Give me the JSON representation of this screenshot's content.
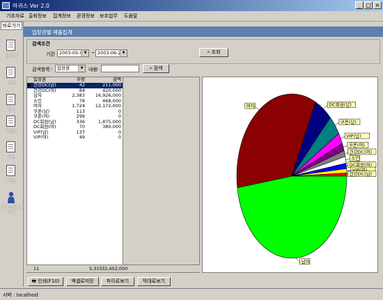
{
  "window": {
    "title": "아귀스 Ver 2.0"
  },
  "menu": [
    "기초자료",
    "출퇴정보",
    "집계정보",
    "환경정보",
    "보조업무",
    "도움말"
  ],
  "sidebar": {
    "shortcut_label": "바로가기",
    "items": [
      {
        "label": "입장권",
        "icon": "document-icon"
      },
      {
        "label": "상품",
        "icon": "document-icon"
      },
      {
        "label": "코너",
        "icon": "document-icon"
      },
      {
        "label": "카운터",
        "icon": "document-icon"
      },
      {
        "label": "카드",
        "icon": "document-icon"
      },
      {
        "label": "계정",
        "icon": "document-icon"
      },
      {
        "label": "아귀스에 대하여",
        "icon": "person-icon"
      }
    ]
  },
  "panel": {
    "title": "입장권별 매출집계"
  },
  "filters": {
    "section_title": "검색조건",
    "period_label": "기간",
    "date_from": "2003-05-02",
    "date_sep": "~",
    "date_to": "2003-06-25",
    "query_button": "조회",
    "search_item_label": "검색항목",
    "search_item_value": "입장권",
    "content_label": "내용",
    "content_value": "",
    "search_button": "검색"
  },
  "table": {
    "columns": [
      "입장권",
      "수량",
      "금액"
    ],
    "rows": [
      {
        "name": "건강DC(남)",
        "qty": "42",
        "amount": "211,000",
        "selected": true
      },
      {
        "name": "건강DC(여)",
        "qty": "84",
        "amount": "420,000"
      },
      {
        "name": "남자",
        "qty": "2,383",
        "amount": "16,926,000"
      },
      {
        "name": "소인",
        "qty": "78",
        "amount": "468,000"
      },
      {
        "name": "여자",
        "qty": "1,724",
        "amount": "12,172,000"
      },
      {
        "name": "쿠폰(남)",
        "qty": "113",
        "amount": "0"
      },
      {
        "name": "쿠폰(여)",
        "qty": "299",
        "amount": "0"
      },
      {
        "name": "DC회원(남)",
        "qty": "336",
        "amount": "1,875,000"
      },
      {
        "name": "DC회원(여)",
        "qty": "70",
        "amount": "380,000"
      },
      {
        "name": "VIP(남)",
        "qty": "137",
        "amount": "0"
      },
      {
        "name": "VIP(여)",
        "qty": "49",
        "amount": "0"
      }
    ],
    "footer": {
      "count": "11",
      "qty": "5,315",
      "amount": "32,452,000"
    }
  },
  "buttons": {
    "print": "인쇄(F10)",
    "excel": "엑셀로저장",
    "pie": "파이로보기",
    "bar": "막대로보기"
  },
  "chart_data": {
    "type": "pie",
    "slices": [
      {
        "label": "남자",
        "value": 16926000,
        "color": "#00ff00"
      },
      {
        "label": "여자",
        "value": 12172000,
        "color": "#8b0000"
      },
      {
        "label": "DC회원(남)",
        "value": 1875000,
        "color": "#000080"
      },
      {
        "label": "쿠폰(남)",
        "value": 1400000,
        "color": "#008080"
      },
      {
        "label": "VIP(남)",
        "value": 780000,
        "color": "#ff00ff"
      },
      {
        "label": "쿠폰(여)",
        "value": 520000,
        "color": "#800080"
      },
      {
        "label": "건강DC(여)",
        "value": 420000,
        "color": "#808080"
      },
      {
        "label": "소인",
        "value": 468000,
        "color": "#ffffff"
      },
      {
        "label": "DC회원(여)",
        "value": 380000,
        "color": "#0000ff"
      },
      {
        "label": "VIP(여)",
        "value": 300000,
        "color": "#ffff00"
      },
      {
        "label": "건강DC(남)",
        "value": 211000,
        "color": "#ff0000"
      }
    ]
  },
  "status": {
    "server": "서버 : localhost"
  }
}
